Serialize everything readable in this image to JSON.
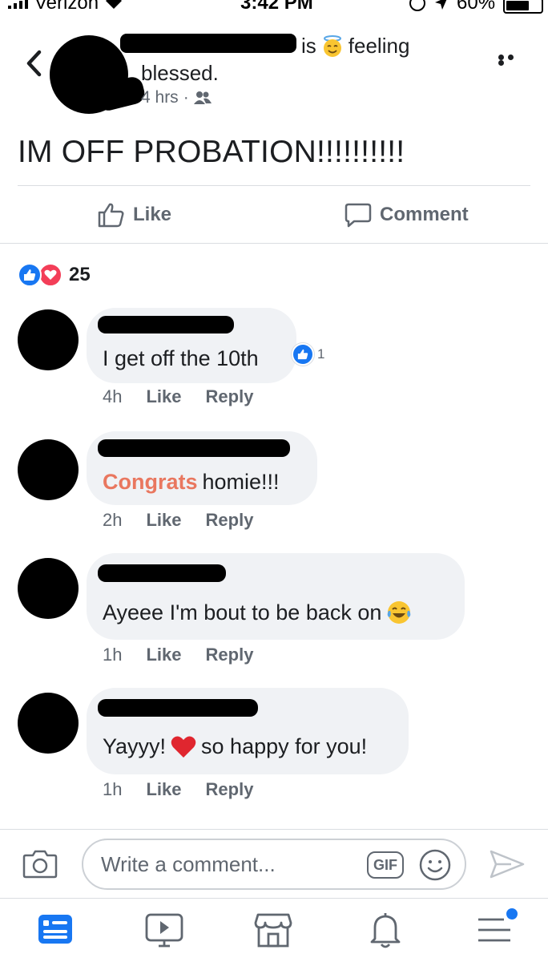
{
  "status_bar": {
    "carrier": "Verizon",
    "time": "3:42 PM",
    "battery": "60%"
  },
  "post": {
    "is_label": "is",
    "feeling_label": "feeling",
    "feeling_value": "blessed.",
    "time": "4 hrs",
    "privacy_icon": "friends-icon",
    "text": "IM OFF PROBATION!!!!!!!!!!"
  },
  "actions": {
    "like": "Like",
    "comment": "Comment"
  },
  "reactions": {
    "count": "25"
  },
  "comments": [
    {
      "text": "I get off the 10th",
      "time": "4h",
      "like": "Like",
      "reply": "Reply",
      "reaction_count": "1"
    },
    {
      "text_highlight": "Congrats",
      "text": "homie!!!",
      "time": "2h",
      "like": "Like",
      "reply": "Reply"
    },
    {
      "text": "Ayeee I'm bout to be back on",
      "emoji": "laughing-tears-icon",
      "time": "1h",
      "like": "Like",
      "reply": "Reply"
    },
    {
      "text_before": "Yayyy!",
      "emoji": "heart-icon",
      "text_after": "so happy for you!",
      "time": "1h",
      "like": "Like",
      "reply": "Reply"
    }
  ],
  "composer": {
    "placeholder": "Write a comment...",
    "gif_label": "GIF"
  },
  "colors": {
    "fb_blue": "#1877f2",
    "love_red": "#f33e58",
    "secondary_text": "#606770",
    "bubble_bg": "#f0f2f5",
    "highlight_text": "#e9775f"
  }
}
